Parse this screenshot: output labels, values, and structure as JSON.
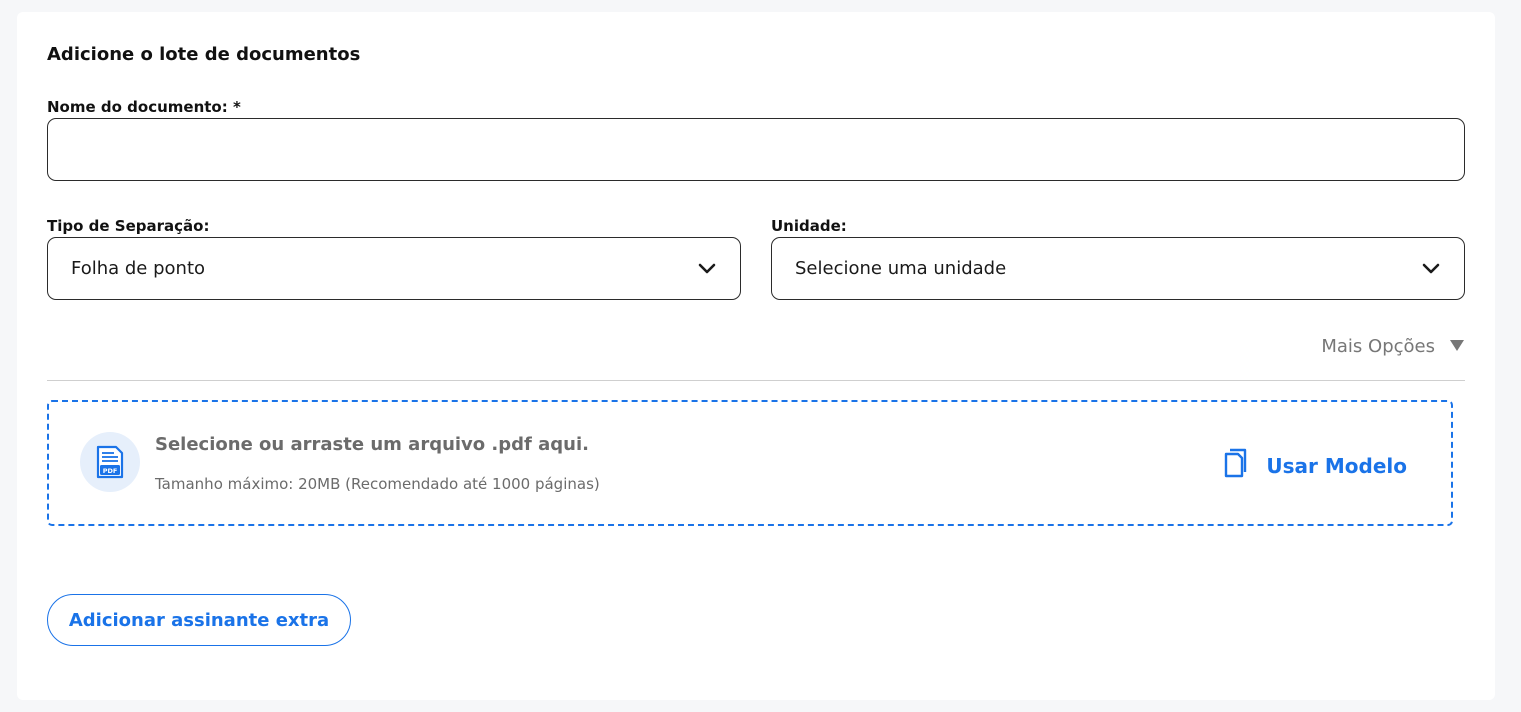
{
  "section": {
    "title": "Adicione o lote de documentos"
  },
  "document_name": {
    "label": "Nome do documento: *",
    "value": "",
    "placeholder": ""
  },
  "separation": {
    "label": "Tipo de Separação:",
    "value": "Folha de ponto",
    "icon": "chevron-down-icon"
  },
  "unit": {
    "label": "Unidade:",
    "value": "Selecione uma unidade",
    "icon": "chevron-down-icon"
  },
  "more_options": {
    "label": "Mais Opções",
    "icon": "triangle-down-icon"
  },
  "upload": {
    "title": "Selecione ou arraste um arquivo .pdf aqui.",
    "subtitle": "Tamanho máximo: 20MB (Recomendado até 1000 páginas)",
    "file_icon": "pdf-file-icon",
    "file_icon_text": "PDF",
    "use_template_label": "Usar Modelo",
    "use_template_icon": "copy-icon"
  },
  "add_signer_button": "Adicionar assinante extra",
  "colors": {
    "accent": "#1a73e8",
    "muted": "#6b6b6b",
    "border": "#2b2b2b"
  }
}
